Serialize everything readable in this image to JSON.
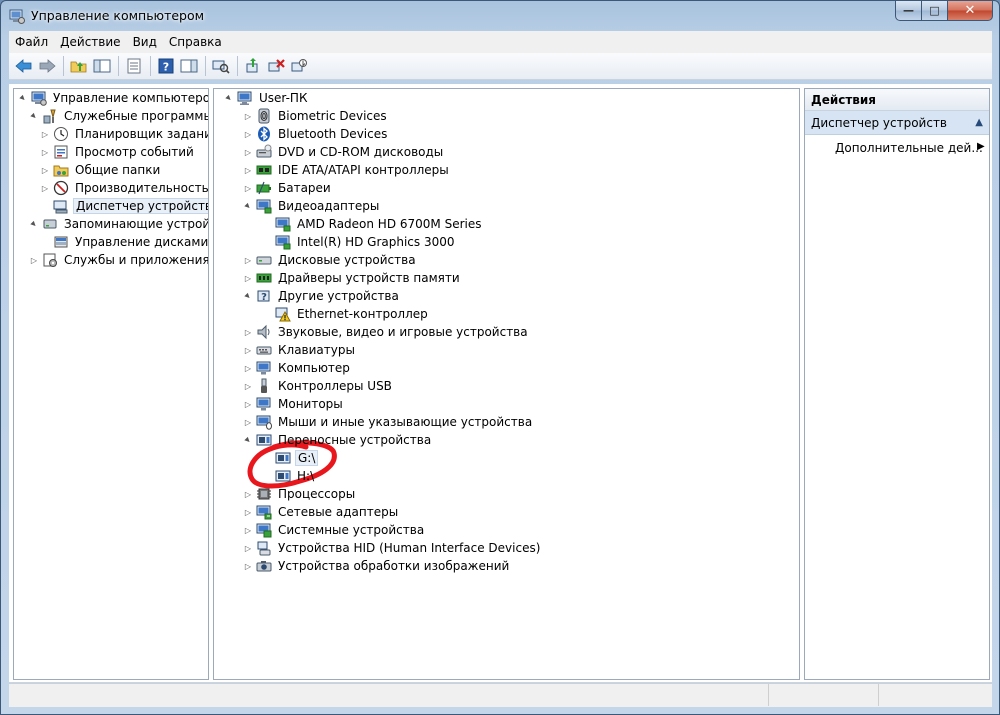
{
  "window": {
    "title": "Управление компьютером",
    "buttons": {
      "minimize": "—",
      "maximize": "□",
      "close": "✕"
    }
  },
  "menu": {
    "items": [
      {
        "label": "Файл"
      },
      {
        "label": "Действие"
      },
      {
        "label": "Вид"
      },
      {
        "label": "Справка"
      }
    ]
  },
  "toolbar": {
    "icons": [
      "back-arrow-icon",
      "forward-arrow-icon",
      "up-folder-icon",
      "show-hide-tree-icon",
      "export-list-icon",
      "help-icon",
      "show-hide-action-pane-icon",
      "scan-hardware-icon",
      "update-driver-icon",
      "uninstall-device-icon",
      "disable-device-icon"
    ]
  },
  "left_tree": {
    "items": [
      {
        "label": "Управление компьютером (л",
        "icon": "computer-management-icon",
        "level": 0,
        "expander": "▲"
      },
      {
        "label": "Служебные программы",
        "icon": "tools-icon",
        "level": 1,
        "expander": "▲"
      },
      {
        "label": "Планировщик заданий",
        "icon": "clock-icon",
        "level": 2,
        "expander": "▷"
      },
      {
        "label": "Просмотр событий",
        "icon": "event-viewer-icon",
        "level": 2,
        "expander": "▷"
      },
      {
        "label": "Общие папки",
        "icon": "shared-folder-icon",
        "level": 2,
        "expander": "▷"
      },
      {
        "label": "Производительность",
        "icon": "performance-icon",
        "level": 2,
        "expander": "▷"
      },
      {
        "label": "Диспетчер устройств",
        "icon": "device-manager-icon",
        "level": 2,
        "expander": "",
        "selected": true
      },
      {
        "label": "Запоминающие устройст",
        "icon": "storage-icon",
        "level": 1,
        "expander": "▲"
      },
      {
        "label": "Управление дисками",
        "icon": "disk-management-icon",
        "level": 2,
        "expander": ""
      },
      {
        "label": "Службы и приложения",
        "icon": "services-icon",
        "level": 1,
        "expander": "▷"
      }
    ]
  },
  "device_tree": {
    "items": [
      {
        "label": "User-ПК",
        "icon": "computer-icon",
        "level": 0,
        "expander": "▲"
      },
      {
        "label": "Biometric Devices",
        "icon": "biometric-icon",
        "level": 1,
        "expander": "▷"
      },
      {
        "label": "Bluetooth Devices",
        "icon": "bluetooth-icon",
        "level": 1,
        "expander": "▷"
      },
      {
        "label": "DVD и CD-ROM дисководы",
        "icon": "dvd-drive-icon",
        "level": 1,
        "expander": "▷"
      },
      {
        "label": "IDE ATA/ATAPI контроллеры",
        "icon": "ide-controller-icon",
        "level": 1,
        "expander": "▷"
      },
      {
        "label": "Батареи",
        "icon": "battery-icon",
        "level": 1,
        "expander": "▷"
      },
      {
        "label": "Видеоадаптеры",
        "icon": "display-adapter-icon",
        "level": 1,
        "expander": "▲"
      },
      {
        "label": "AMD Radeon HD 6700M Series",
        "icon": "display-adapter-icon",
        "level": 2,
        "expander": ""
      },
      {
        "label": "Intel(R) HD Graphics 3000",
        "icon": "display-adapter-icon",
        "level": 2,
        "expander": ""
      },
      {
        "label": "Дисковые устройства",
        "icon": "disk-drive-icon",
        "level": 1,
        "expander": "▷"
      },
      {
        "label": "Драйверы устройств памяти",
        "icon": "memory-device-icon",
        "level": 1,
        "expander": "▷"
      },
      {
        "label": "Другие устройства",
        "icon": "other-devices-icon",
        "level": 1,
        "expander": "▲"
      },
      {
        "label": "Ethernet-контроллер",
        "icon": "warning-device-icon",
        "level": 2,
        "expander": ""
      },
      {
        "label": "Звуковые, видео и игровые устройства",
        "icon": "speaker-icon",
        "level": 1,
        "expander": "▷"
      },
      {
        "label": "Клавиатуры",
        "icon": "keyboard-icon",
        "level": 1,
        "expander": "▷"
      },
      {
        "label": "Компьютер",
        "icon": "monitor-icon",
        "level": 1,
        "expander": "▷"
      },
      {
        "label": "Контроллеры USB",
        "icon": "usb-icon",
        "level": 1,
        "expander": "▷"
      },
      {
        "label": "Мониторы",
        "icon": "monitor-icon",
        "level": 1,
        "expander": "▷"
      },
      {
        "label": "Мыши и иные указывающие устройства",
        "icon": "mouse-icon",
        "level": 1,
        "expander": "▷"
      },
      {
        "label": "Переносные устройства",
        "icon": "portable-device-icon",
        "level": 1,
        "expander": "▲"
      },
      {
        "label": "G:\\",
        "icon": "portable-device-icon",
        "level": 2,
        "expander": "",
        "selected": true
      },
      {
        "label": "H:\\",
        "icon": "portable-device-icon",
        "level": 2,
        "expander": ""
      },
      {
        "label": "Процессоры",
        "icon": "processor-icon",
        "level": 1,
        "expander": "▷"
      },
      {
        "label": "Сетевые адаптеры",
        "icon": "network-adapter-icon",
        "level": 1,
        "expander": "▷"
      },
      {
        "label": "Системные устройства",
        "icon": "system-device-icon",
        "level": 1,
        "expander": "▷"
      },
      {
        "label": "Устройства HID (Human Interface Devices)",
        "icon": "hid-icon",
        "level": 1,
        "expander": "▷"
      },
      {
        "label": "Устройства обработки изображений",
        "icon": "imaging-device-icon",
        "level": 1,
        "expander": "▷"
      }
    ]
  },
  "actions": {
    "header": "Действия",
    "section": "Диспетчер устройств",
    "section_toggle": "▲",
    "item": "Дополнительные дей...",
    "item_arrow": "▶"
  },
  "colors": {
    "annotation": "#e8161d"
  }
}
